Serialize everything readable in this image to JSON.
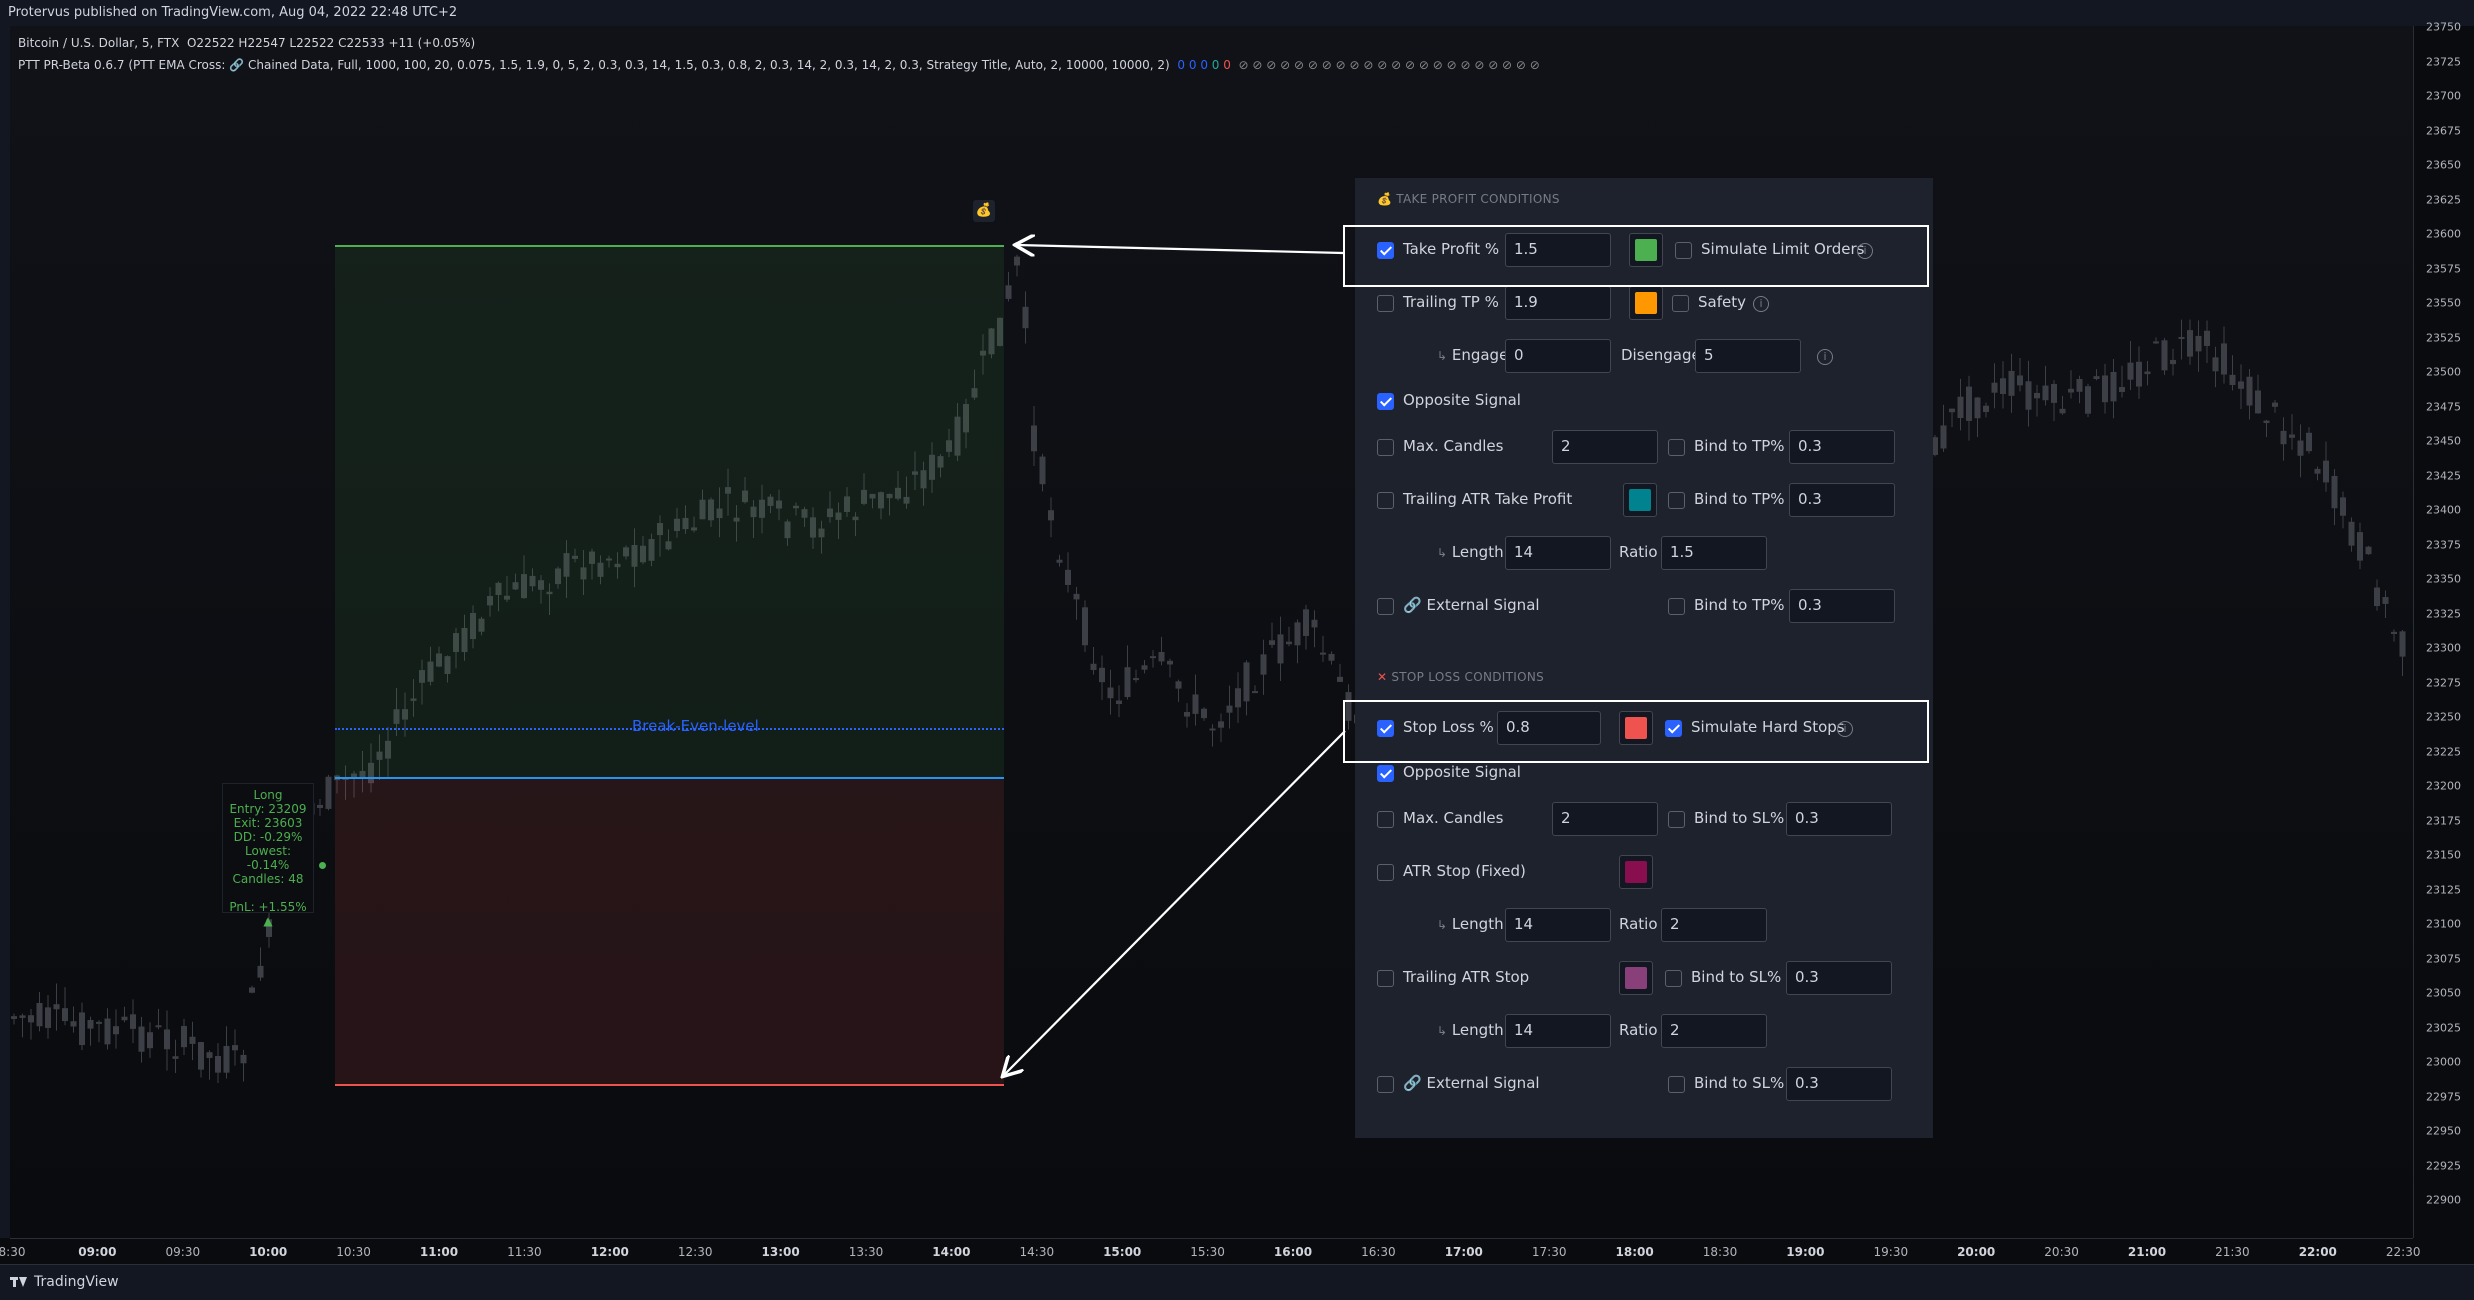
{
  "header": {
    "published": "Protervus published on TradingView.com, Aug 04, 2022 22:48 UTC+2"
  },
  "legend": {
    "symbol": "Bitcoin / U.S. Dollar, 5, FTX",
    "ohlc": "O22522  H22547  L22522  C22533  +11 (+0.05%)",
    "indicator": "PTT PR-Beta 0.6.7 (PTT EMA Cross: 🔗 Chained Data, Full, 1000, 100, 20, 0.075, 1.5, 1.9, 0, 5, 2, 0.3, 0.3, 14, 1.5, 0.3, 0.8, 2, 0.3, 14, 2, 0.3, 14, 2, 0.3, Strategy Title, Auto, 2, 10000, 10000, 2)",
    "status_dots": [
      "0",
      "0",
      "0",
      "0",
      "0"
    ],
    "hidden_marks": "⊘ ⊘ ⊘ ⊘ ⊘ ⊘ ⊘ ⊘ ⊘ ⊘ ⊘ ⊘ ⊘ ⊘ ⊘ ⊘ ⊘ ⊘ ⊘ ⊘ ⊘ ⊘"
  },
  "price_axis": [
    "23750",
    "23725",
    "23700",
    "23675",
    "23650",
    "23625",
    "23600",
    "23575",
    "23550",
    "23525",
    "23500",
    "23475",
    "23450",
    "23425",
    "23400",
    "23375",
    "23350",
    "23325",
    "23300",
    "23275",
    "23250",
    "23225",
    "23200",
    "23175",
    "23150",
    "23125",
    "23100",
    "23075",
    "23050",
    "23025",
    "23000",
    "22975",
    "22950",
    "22925",
    "22900"
  ],
  "time_axis": [
    {
      "t": "8:30",
      "bold": false
    },
    {
      "t": "09:00",
      "bold": true
    },
    {
      "t": "09:30",
      "bold": false
    },
    {
      "t": "10:00",
      "bold": true
    },
    {
      "t": "10:30",
      "bold": false
    },
    {
      "t": "11:00",
      "bold": true
    },
    {
      "t": "11:30",
      "bold": false
    },
    {
      "t": "12:00",
      "bold": true
    },
    {
      "t": "12:30",
      "bold": false
    },
    {
      "t": "13:00",
      "bold": true
    },
    {
      "t": "13:30",
      "bold": false
    },
    {
      "t": "14:00",
      "bold": true
    },
    {
      "t": "14:30",
      "bold": false
    },
    {
      "t": "15:00",
      "bold": true
    },
    {
      "t": "15:30",
      "bold": false
    },
    {
      "t": "16:00",
      "bold": true
    },
    {
      "t": "16:30",
      "bold": false
    },
    {
      "t": "17:00",
      "bold": true
    },
    {
      "t": "17:30",
      "bold": false
    },
    {
      "t": "18:00",
      "bold": true
    },
    {
      "t": "18:30",
      "bold": false
    },
    {
      "t": "19:00",
      "bold": true
    },
    {
      "t": "19:30",
      "bold": false
    },
    {
      "t": "20:00",
      "bold": true
    },
    {
      "t": "20:30",
      "bold": false
    },
    {
      "t": "21:00",
      "bold": true
    },
    {
      "t": "21:30",
      "bold": false
    },
    {
      "t": "22:00",
      "bold": true
    },
    {
      "t": "22:30",
      "bold": false
    }
  ],
  "chart": {
    "break_even_label": "Break-Even-level",
    "trade": {
      "side": "Long",
      "entry": "Entry: 23209",
      "exit": "Exit: 23603",
      "dd": "DD: -0.29%",
      "lowest": "Lowest: -0.14%",
      "candles": "Candles: 48",
      "pnl": "PnL: +1.55% ▲"
    },
    "colors": {
      "tp": "#4caf50",
      "sl": "#ef5350",
      "entry": "#2196f3",
      "be": "#2962ff"
    }
  },
  "panel": {
    "tp_title": "TAKE PROFIT CONDITIONS",
    "tp_icon": "money-bag-icon",
    "sl_title": "STOP LOSS CONDITIONS",
    "sl_icon": "cross-icon",
    "take_profit": {
      "label": "Take Profit %",
      "value": "1.5",
      "checked": true,
      "color": "#4caf50",
      "sim_label": "Simulate Limit Orders",
      "sim_checked": false
    },
    "trailing_tp": {
      "label": "Trailing TP %",
      "value": "1.9",
      "checked": false,
      "color": "#ff9800",
      "safety_label": "Safety",
      "safety_checked": false
    },
    "engage": {
      "label": "Engage",
      "value": "0",
      "dis_label": "Disengage",
      "dis_value": "5"
    },
    "opposite_tp": {
      "label": "Opposite Signal",
      "checked": true
    },
    "max_candles_tp": {
      "label": "Max. Candles",
      "value": "2",
      "bind_label": "Bind to TP%",
      "bind_value": "0.3"
    },
    "trailing_atr_tp": {
      "label": "Trailing ATR Take Profit",
      "color": "#00838f",
      "bind_label": "Bind to TP%",
      "bind_value": "0.3"
    },
    "tp_length": {
      "label": "Length",
      "value": "14",
      "ratio_label": "Ratio",
      "ratio_value": "1.5"
    },
    "ext_tp": {
      "label": "External Signal",
      "bind_label": "Bind to TP%",
      "bind_value": "0.3"
    },
    "stop_loss": {
      "label": "Stop Loss %",
      "value": "0.8",
      "checked": true,
      "color": "#ef5350",
      "sim_label": "Simulate Hard Stops",
      "sim_checked": true
    },
    "opposite_sl": {
      "label": "Opposite Signal",
      "checked": true
    },
    "max_candles_sl": {
      "label": "Max. Candles",
      "value": "2",
      "bind_label": "Bind to SL%",
      "bind_value": "0.3"
    },
    "atr_stop": {
      "label": "ATR Stop (Fixed)",
      "color": "#880e4f"
    },
    "atr_length": {
      "label": "Length",
      "value": "14",
      "ratio_label": "Ratio",
      "ratio_value": "2"
    },
    "trailing_atr_stop": {
      "label": "Trailing ATR Stop",
      "color": "#883f7a",
      "bind_label": "Bind to SL%",
      "bind_value": "0.3"
    },
    "tas_length": {
      "label": "Length",
      "value": "14",
      "ratio_label": "Ratio",
      "ratio_value": "2"
    },
    "ext_sl": {
      "label": "External Signal",
      "bind_label": "Bind to SL%",
      "bind_value": "0.3"
    }
  },
  "footer": {
    "brand": "TradingView"
  }
}
